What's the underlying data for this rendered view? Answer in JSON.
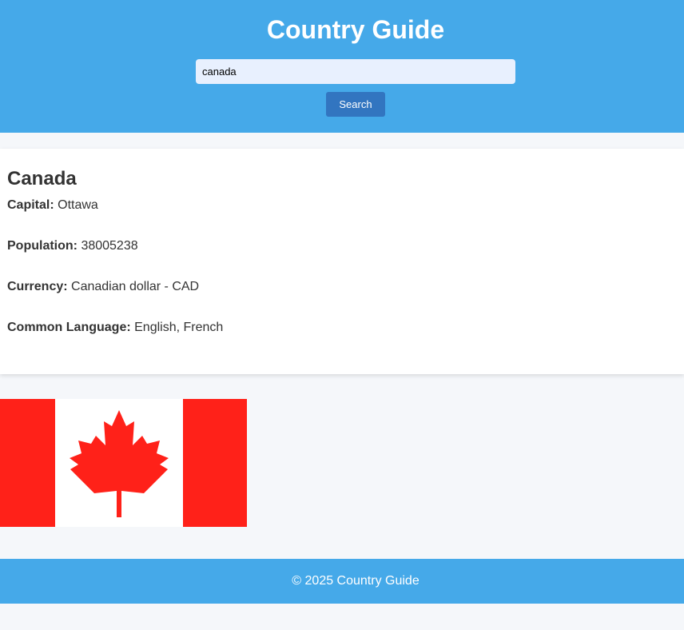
{
  "header": {
    "title": "Country Guide",
    "search_value": "canada",
    "search_button_label": "Search"
  },
  "country": {
    "name": "Canada",
    "fields": [
      {
        "label": "Capital:",
        "value": "Ottawa"
      },
      {
        "label": "Population:",
        "value": "38005238"
      },
      {
        "label": "Currency:",
        "value": "Canadian dollar - CAD"
      },
      {
        "label": "Common Language:",
        "value": "English, French"
      }
    ]
  },
  "flag": {
    "icon": "canada-flag-maple-leaf",
    "colors": {
      "red": "#ff2119",
      "white": "#ffffff"
    }
  },
  "footer": {
    "text": "© 2025 Country Guide"
  },
  "colors": {
    "header_bg": "#45a9e9",
    "button_bg": "#3275c0",
    "input_bg": "#e8f0fe",
    "page_bg": "#f5f7fa"
  }
}
